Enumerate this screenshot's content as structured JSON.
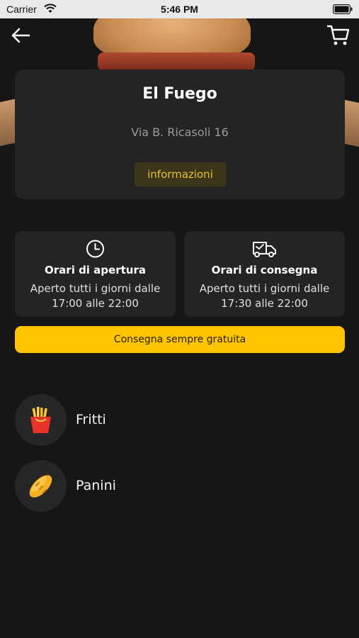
{
  "status_bar": {
    "carrier": "Carrier",
    "time": "5:46 PM",
    "wifi_icon": "wifi-icon",
    "battery_icon": "battery-icon"
  },
  "header": {
    "back_icon": "arrow-left-icon",
    "cart_icon": "cart-icon"
  },
  "restaurant": {
    "name": "El Fuego",
    "address": "Via B. Ricasoli 16",
    "info_button": "informazioni"
  },
  "hours": {
    "opening": {
      "icon": "clock-icon",
      "title": "Orari di apertura",
      "description": "Aperto tutti i giorni dalle 17:00 alle 22:00"
    },
    "delivery": {
      "icon": "delivery-truck-icon",
      "title": "Orari di consegna",
      "description": "Aperto tutti i giorni dalle 17:30 alle 22:00"
    }
  },
  "banner": {
    "text": "Consegna sempre gratuita"
  },
  "categories": [
    {
      "label": "Fritti",
      "icon": "fries-icon"
    },
    {
      "label": "Panini",
      "icon": "bread-icon"
    }
  ],
  "colors": {
    "background": "#161616",
    "card": "#242424",
    "accent": "#ffc400",
    "info_button_bg": "#3d3519",
    "info_button_text": "#e7c22c"
  }
}
